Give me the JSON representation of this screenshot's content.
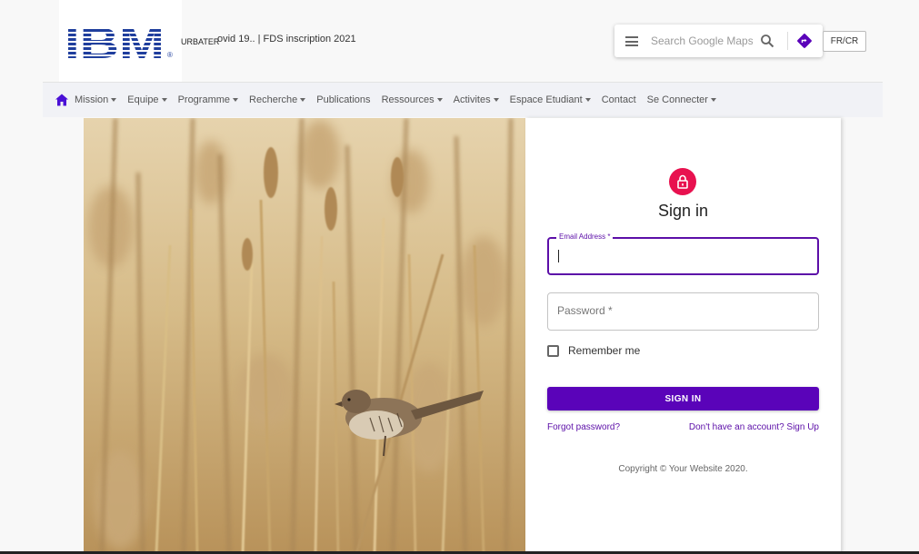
{
  "header": {
    "logo_text": "IBM",
    "logo_registered": "®",
    "marquee_left": "URBATER",
    "marquee_right": "ovid 19.. | FDS inscription 2021",
    "search": {
      "placeholder": "Search Google Maps"
    },
    "lang_button": "FR/CR"
  },
  "nav": {
    "items": [
      {
        "label": "Mission",
        "dropdown": true
      },
      {
        "label": "Equipe",
        "dropdown": true
      },
      {
        "label": "Programme",
        "dropdown": true
      },
      {
        "label": "Recherche",
        "dropdown": true
      },
      {
        "label": "Publications",
        "dropdown": false
      },
      {
        "label": "Ressources",
        "dropdown": true
      },
      {
        "label": "Activites",
        "dropdown": true
      },
      {
        "label": "Espace Etudiant",
        "dropdown": true
      },
      {
        "label": "Contact",
        "dropdown": false
      },
      {
        "label": "Se Connecter",
        "dropdown": true
      }
    ]
  },
  "form": {
    "title": "Sign in",
    "email_label": "Email Address *",
    "password_placeholder": "Password *",
    "remember_label": "Remember me",
    "submit_label": "SIGN IN",
    "forgot_link": "Forgot password?",
    "signup_link": "Don't have an account? Sign Up",
    "copyright": "Copyright © Your Website 2020."
  },
  "colors": {
    "accent": "#5a03b9",
    "lock": "#e8114f",
    "ibm_blue": "#1f3e9d",
    "nav_bg": "#f1f2f6"
  },
  "icons": {
    "home": "home-icon",
    "menu": "hamburger-menu-icon",
    "search": "search-icon",
    "directions": "directions-icon",
    "lock": "lock-icon"
  }
}
